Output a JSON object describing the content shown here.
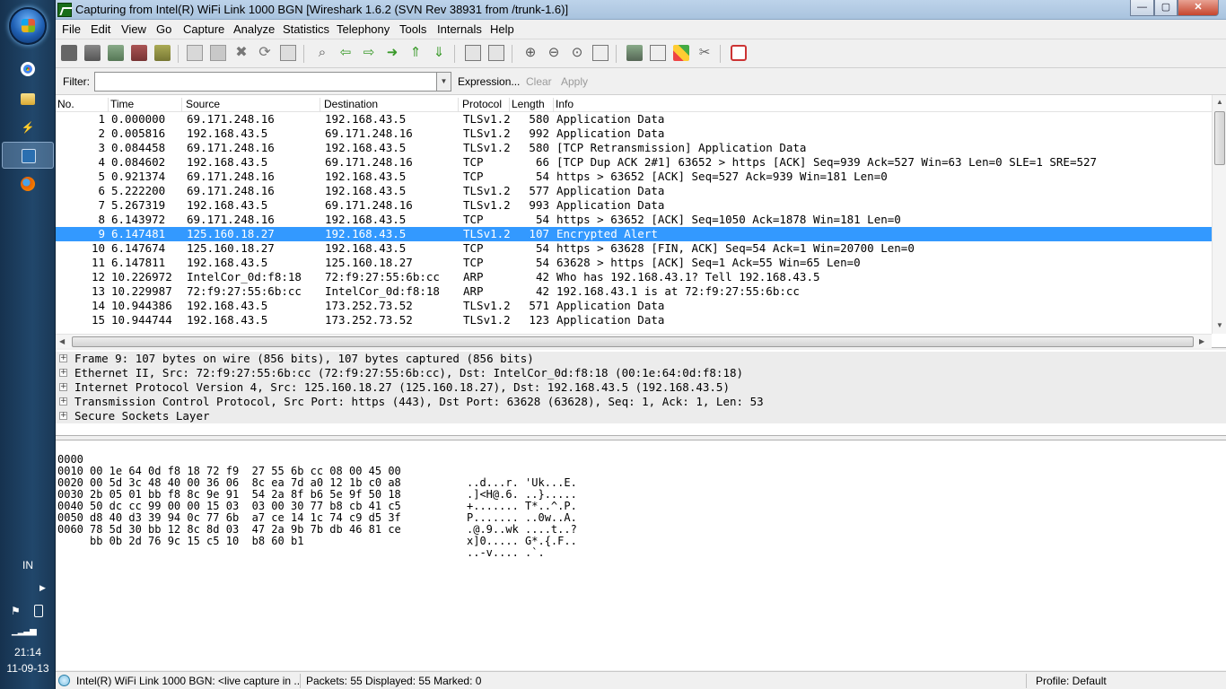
{
  "taskbar": {
    "keyboard_lang": "IN",
    "clock_time": "21:14",
    "clock_date": "11-09-13"
  },
  "window": {
    "title": "Capturing from Intel(R) WiFi Link 1000 BGN   [Wireshark 1.6.2  (SVN Rev 38931 from /trunk-1.6)]",
    "minimize": "—",
    "maximize": "▢",
    "close": "✕"
  },
  "menu": [
    "File",
    "Edit",
    "View",
    "Go",
    "Capture",
    "Analyze",
    "Statistics",
    "Telephony",
    "Tools",
    "Internals",
    "Help"
  ],
  "filter": {
    "label": "Filter:",
    "value": "",
    "expression": "Expression...",
    "clear": "Clear",
    "apply": "Apply"
  },
  "columns": [
    "No.",
    "Time",
    "Source",
    "Destination",
    "Protocol",
    "Length",
    "Info"
  ],
  "packets": [
    {
      "no": "1",
      "time": "0.000000",
      "src": "69.171.248.16",
      "dst": "192.168.43.5",
      "proto": "TLSv1.2",
      "len": "580",
      "info": "Application Data"
    },
    {
      "no": "2",
      "time": "0.005816",
      "src": "192.168.43.5",
      "dst": "69.171.248.16",
      "proto": "TLSv1.2",
      "len": "992",
      "info": "Application Data"
    },
    {
      "no": "3",
      "time": "0.084458",
      "src": "69.171.248.16",
      "dst": "192.168.43.5",
      "proto": "TLSv1.2",
      "len": "580",
      "info": "[TCP Retransmission] Application Data"
    },
    {
      "no": "4",
      "time": "0.084602",
      "src": "192.168.43.5",
      "dst": "69.171.248.16",
      "proto": "TCP",
      "len": "66",
      "info": "[TCP Dup ACK 2#1] 63652 > https [ACK] Seq=939 Ack=527 Win=63 Len=0 SLE=1 SRE=527"
    },
    {
      "no": "5",
      "time": "0.921374",
      "src": "69.171.248.16",
      "dst": "192.168.43.5",
      "proto": "TCP",
      "len": "54",
      "info": "https > 63652 [ACK] Seq=527 Ack=939 Win=181 Len=0"
    },
    {
      "no": "6",
      "time": "5.222200",
      "src": "69.171.248.16",
      "dst": "192.168.43.5",
      "proto": "TLSv1.2",
      "len": "577",
      "info": "Application Data"
    },
    {
      "no": "7",
      "time": "5.267319",
      "src": "192.168.43.5",
      "dst": "69.171.248.16",
      "proto": "TLSv1.2",
      "len": "993",
      "info": "Application Data"
    },
    {
      "no": "8",
      "time": "6.143972",
      "src": "69.171.248.16",
      "dst": "192.168.43.5",
      "proto": "TCP",
      "len": "54",
      "info": "https > 63652 [ACK] Seq=1050 Ack=1878 Win=181 Len=0"
    },
    {
      "no": "9",
      "time": "6.147481",
      "src": "125.160.18.27",
      "dst": "192.168.43.5",
      "proto": "TLSv1.2",
      "len": "107",
      "info": "Encrypted Alert",
      "selected": true
    },
    {
      "no": "10",
      "time": "6.147674",
      "src": "125.160.18.27",
      "dst": "192.168.43.5",
      "proto": "TCP",
      "len": "54",
      "info": "https > 63628 [FIN, ACK] Seq=54 Ack=1 Win=20700 Len=0"
    },
    {
      "no": "11",
      "time": "6.147811",
      "src": "192.168.43.5",
      "dst": "125.160.18.27",
      "proto": "TCP",
      "len": "54",
      "info": "63628 > https [ACK] Seq=1 Ack=55 Win=65 Len=0"
    },
    {
      "no": "12",
      "time": "10.226972",
      "src": "IntelCor_0d:f8:18",
      "dst": "72:f9:27:55:6b:cc",
      "proto": "ARP",
      "len": "42",
      "info": "Who has 192.168.43.1?  Tell 192.168.43.5"
    },
    {
      "no": "13",
      "time": "10.229987",
      "src": "72:f9:27:55:6b:cc",
      "dst": "IntelCor_0d:f8:18",
      "proto": "ARP",
      "len": "42",
      "info": "192.168.43.1 is at 72:f9:27:55:6b:cc"
    },
    {
      "no": "14",
      "time": "10.944386",
      "src": "192.168.43.5",
      "dst": "173.252.73.52",
      "proto": "TLSv1.2",
      "len": "571",
      "info": "Application Data"
    },
    {
      "no": "15",
      "time": "10.944744",
      "src": "192.168.43.5",
      "dst": "173.252.73.52",
      "proto": "TLSv1.2",
      "len": "123",
      "info": "Application Data"
    }
  ],
  "details": [
    "Frame 9: 107 bytes on wire (856 bits), 107 bytes captured (856 bits)",
    "Ethernet II, Src: 72:f9:27:55:6b:cc (72:f9:27:55:6b:cc), Dst: IntelCor_0d:f8:18 (00:1e:64:0d:f8:18)",
    "Internet Protocol Version 4, Src: 125.160.18.27 (125.160.18.27), Dst: 192.168.43.5 (192.168.43.5)",
    "Transmission Control Protocol, Src Port: https (443), Dst Port: 63628 (63628), Seq: 1, Ack: 1, Len: 53",
    "Secure Sockets Layer"
  ],
  "hex": [
    {
      "offset": "0000",
      "bytes": "00 1e 64 0d f8 18 72 f9  27 55 6b cc 08 00 45 00",
      "ascii": "..d...r. 'Uk...E."
    },
    {
      "offset": "0010",
      "bytes": "00 5d 3c 48 40 00 36 06  8c ea 7d a0 12 1b c0 a8",
      "ascii": ".]<H@.6. ..}....."
    },
    {
      "offset": "0020",
      "bytes": "2b 05 01 bb f8 8c 9e 91  54 2a 8f b6 5e 9f 50 18",
      "ascii": "+....... T*..^.P."
    },
    {
      "offset": "0030",
      "bytes": "50 dc cc 99 00 00 15 03  03 00 30 77 b8 cb 41 c5",
      "ascii": "P....... ..0w..A."
    },
    {
      "offset": "0040",
      "bytes": "d8 40 d3 39 94 0c 77 6b  a7 ce 14 1c 74 c9 d5 3f",
      "ascii": ".@.9..wk ....t..?"
    },
    {
      "offset": "0050",
      "bytes": "78 5d 30 bb 12 8c 8d 03  47 2a 9b 7b db 46 81 ce",
      "ascii": "x]0..... G*.{.F.."
    },
    {
      "offset": "0060",
      "bytes": "bb 0b 2d 76 9c 15 c5 10  b8 60 b1",
      "ascii": "..-v.... .`."
    }
  ],
  "status": {
    "interface": "Intel(R) WiFi Link 1000 BGN: <live capture in ...",
    "packets": "Packets: 55 Displayed: 55 Marked: 0",
    "profile": "Profile: Default"
  },
  "colors": {
    "selection": "#3399ff",
    "detail_row": "#ececec"
  }
}
